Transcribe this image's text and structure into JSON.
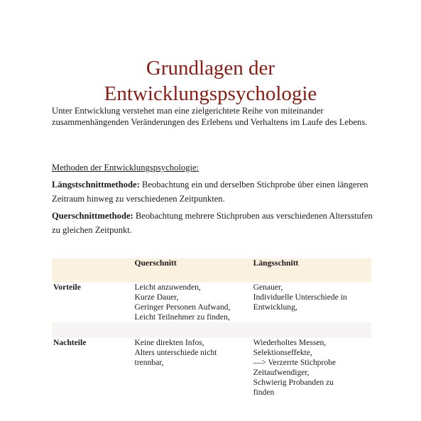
{
  "title_line1": "Grundlagen der",
  "title_line2": "Entwicklungspsychologie",
  "intro": "Unter Entwicklung verstehet man eine zielgerichtete Reihe von miteinander zusammenhängenden Veränderungen des Erlebens und Verhaltens im Laufe des Lebens.",
  "section_heading": "Methoden der Entwicklungspsychologie:",
  "methods": [
    {
      "term": "Längstschnittmethode:",
      "text": " Beobachtung ein und derselben Stichprobe über einen längeren Zeitraum hinweg zu verschiedenen Zeitpunkten."
    },
    {
      "term": "Querschnittmethode:",
      "text": " Beobachtung mehrere Stichproben aus verschiedenen Altersstufen zu gleichen Zeitpunkt."
    }
  ],
  "table": {
    "headers": [
      "",
      "Querschnitt",
      "Längsschnitt"
    ],
    "rows": [
      {
        "label": "Vorteile",
        "col1": [
          "Leicht anzuwenden,",
          "Kurze Dauer,",
          "Geringer Personen Aufwand,",
          "Leicht Teilnehmer zu finden,"
        ],
        "col2": [
          "Genauer,",
          "Individuelle Unterschiede in",
          "Entwicklung,"
        ]
      },
      {
        "label": "Nachteile",
        "col1": [
          "Keine direkten Infos,",
          "Alters unterschiede nicht",
          "trennbar,"
        ],
        "col2": [
          "Wiederholtes Messen,",
          "Selektionseffekte,",
          "—> Verzerrte Stichprobe",
          "Zeitaufwendiger,",
          "Schwierig Probanden zu",
          "finden"
        ]
      }
    ]
  }
}
